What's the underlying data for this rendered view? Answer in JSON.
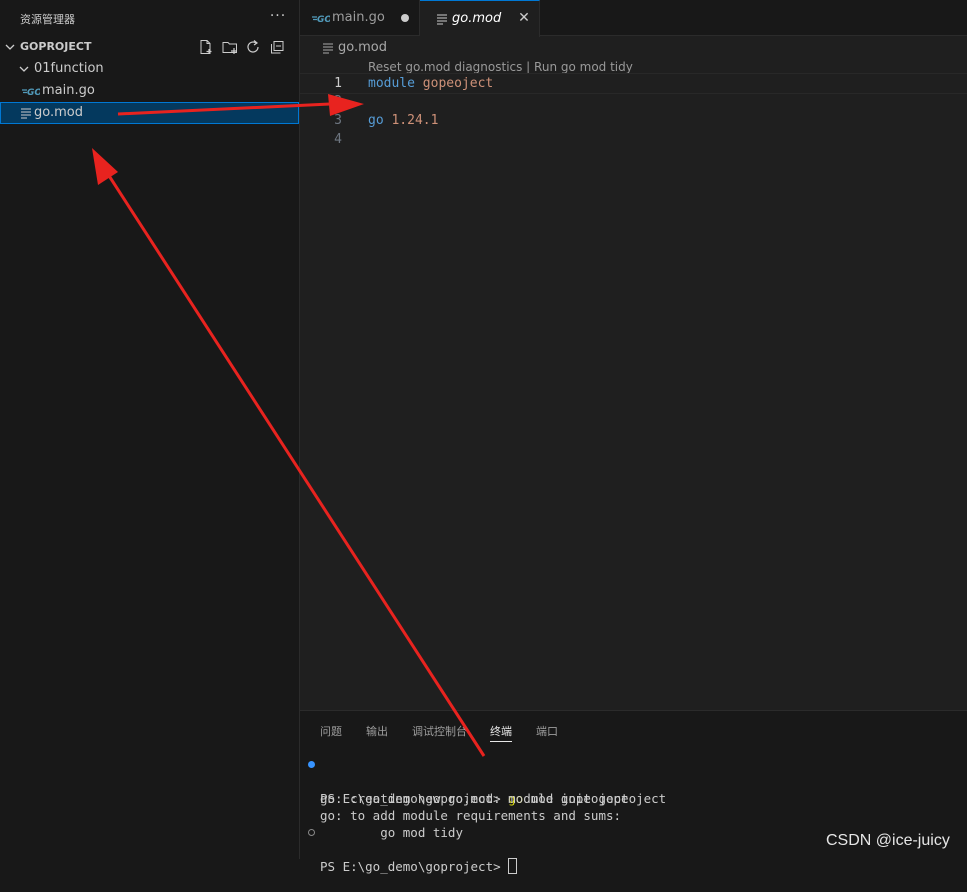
{
  "sidebar": {
    "title": "资源管理器",
    "more_label": "···",
    "project": "GOPROJECT",
    "folder": "01function",
    "files": [
      "main.go",
      "go.mod"
    ],
    "toolbar_icons": [
      "new-file-icon",
      "new-folder-icon",
      "refresh-icon",
      "collapse-all-icon"
    ]
  },
  "tabs": [
    {
      "label": "main.go",
      "icon": "go-icon",
      "state": "modified"
    },
    {
      "label": "go.mod",
      "icon": "lines-icon",
      "state": "active"
    }
  ],
  "breadcrumb": "go.mod",
  "codelens": "Reset go.mod diagnostics | Run go mod tidy",
  "code": {
    "line_numbers": [
      "1",
      "2",
      "3",
      "4"
    ],
    "line1": {
      "keyword": "module",
      "value": "gopeoject"
    },
    "line3": {
      "keyword": "go",
      "value": "1.24.1"
    }
  },
  "panel": {
    "tabs": [
      "问题",
      "输出",
      "调试控制台",
      "终端",
      "端口"
    ],
    "active_tab": "终端"
  },
  "terminal": {
    "prompt": "PS E:\\go_demo\\goproject> ",
    "command_word": "go",
    "command_rest": " mod init gopeoject",
    "out1": "go: creating new go.mod: module gopeoject",
    "out2": "go: to add module requirements and sums:",
    "out3": "        go mod tidy",
    "prompt2": "PS E:\\go_demo\\goproject> "
  },
  "watermark": "CSDN @ice-juicy",
  "colors": {
    "accent": "#0078d4",
    "selection": "#04395e",
    "go_blue": "#519aba",
    "annotation_red": "#e8231f",
    "keyword": "#569cd6",
    "string": "#ce9178",
    "command_yellow": "#e5e510"
  }
}
